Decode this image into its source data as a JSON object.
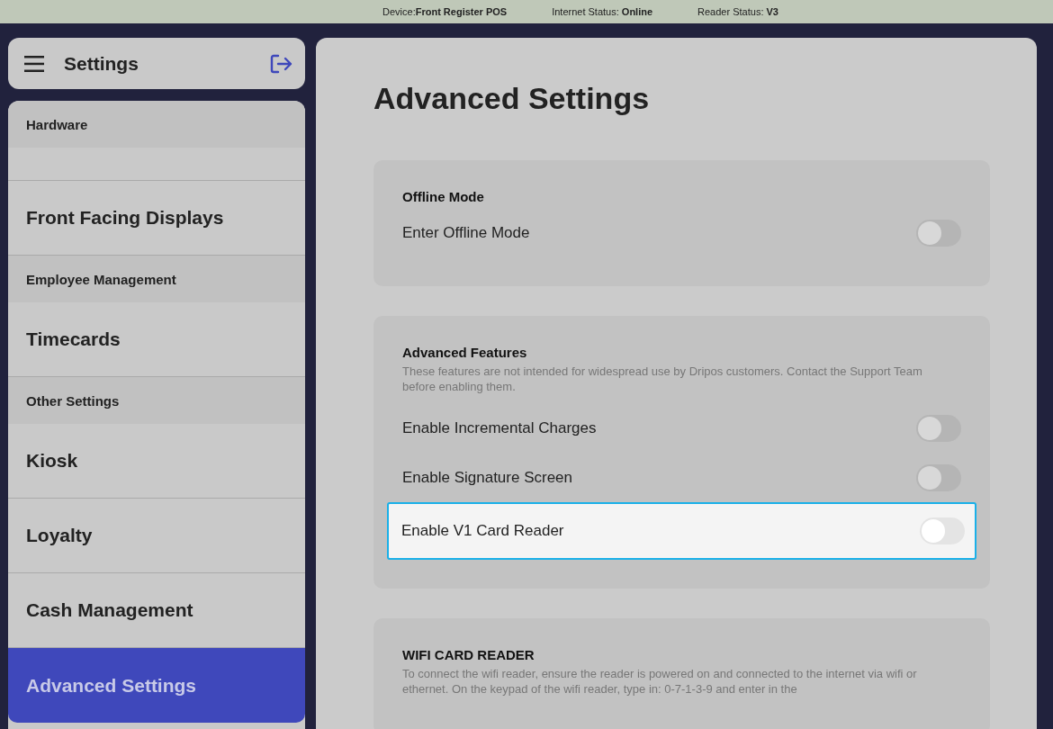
{
  "status_bar": [
    {
      "label": "Device:",
      "value": "Front Register POS"
    },
    {
      "label": "Internet Status: ",
      "value": "Online"
    },
    {
      "label": "Reader Status: ",
      "value": "V3"
    }
  ],
  "sidebar": {
    "title": "Settings",
    "items": [
      {
        "kind": "header",
        "label": "Hardware"
      },
      {
        "kind": "gap"
      },
      {
        "kind": "item",
        "label": "Front Facing Displays",
        "selected": false
      },
      {
        "kind": "header",
        "label": "Employee Management"
      },
      {
        "kind": "item",
        "label": "Timecards",
        "selected": false
      },
      {
        "kind": "header",
        "label": "Other Settings"
      },
      {
        "kind": "item",
        "label": "Kiosk",
        "selected": false
      },
      {
        "kind": "item",
        "label": "Loyalty",
        "selected": false
      },
      {
        "kind": "item",
        "label": "Cash Management",
        "selected": false
      },
      {
        "kind": "item",
        "label": "Advanced Settings",
        "selected": true
      }
    ]
  },
  "page_title": "Advanced Settings",
  "sections": [
    {
      "title": "Offline Mode",
      "rows": [
        {
          "label": "Enter Offline Mode",
          "on": false,
          "focused": false
        }
      ]
    },
    {
      "title": "Advanced Features",
      "description": "These features are not intended for widespread use by Dripos customers. Contact the Support Team before enabling them.",
      "rows": [
        {
          "label": "Enable Incremental Charges",
          "on": false,
          "focused": false
        },
        {
          "label": "Enable Signature Screen",
          "on": false,
          "focused": false
        },
        {
          "label": "Enable V1 Card Reader",
          "on": false,
          "focused": true
        }
      ]
    },
    {
      "title": "WIFI CARD READER",
      "description": "To connect the wifi reader, ensure the reader is powered on and connected to the internet via wifi or ethernet. On the keypad of the wifi reader, type in: 0-7-1-3-9 and enter in the"
    }
  ]
}
